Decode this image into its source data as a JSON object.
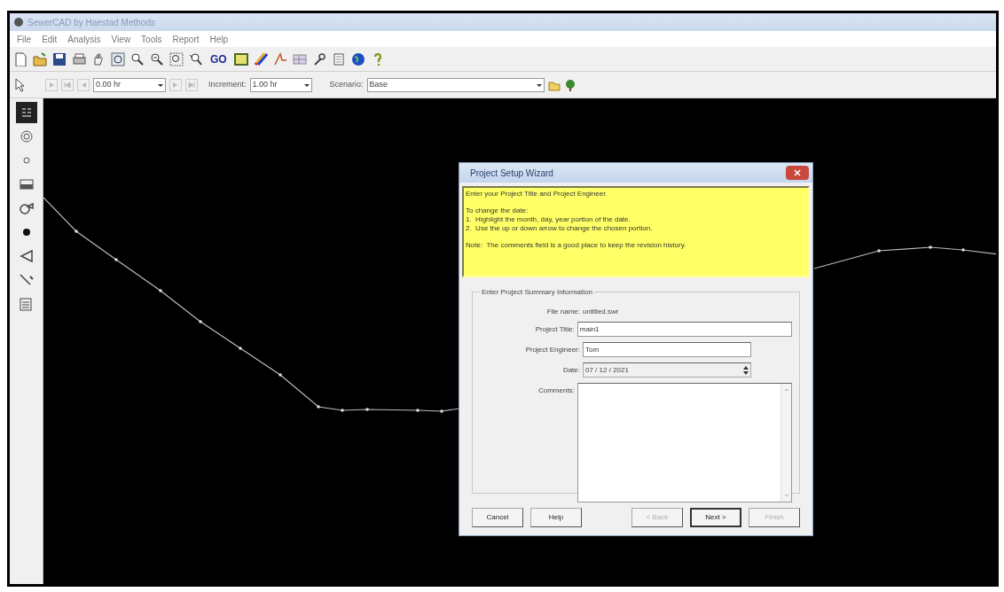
{
  "window": {
    "title": "SewerCAD by Haestad Methods"
  },
  "menu": [
    "File",
    "Edit",
    "Analysis",
    "View",
    "Tools",
    "Report",
    "Help"
  ],
  "toolbar": {
    "go_label": "GO"
  },
  "time_bar": {
    "time": "0.00 hr",
    "increment_label": "Increment:",
    "increment": "1.00 hr",
    "scenario_label": "Scenario:",
    "scenario": "Base"
  },
  "palette": [
    {
      "kind": "label",
      "selected": true
    },
    {
      "kind": "manhole",
      "selected": false
    },
    {
      "kind": "junction",
      "selected": false
    },
    {
      "kind": "wetwell",
      "selected": false
    },
    {
      "kind": "pump",
      "selected": false
    },
    {
      "kind": "node",
      "selected": false
    },
    {
      "kind": "outlet",
      "selected": false
    },
    {
      "kind": "pipe",
      "selected": false
    },
    {
      "kind": "report",
      "selected": false
    }
  ],
  "dialog": {
    "title": "Project Setup Wizard",
    "help_paragraphs": [
      [
        "Enter your Project Title and Project Engineer."
      ],
      [
        "To change the date:",
        "1.  Highlight the month, day, year portion of the date.",
        "2.  Use the up or down arrow to change the chosen portion."
      ],
      [
        "Note:  The comments field is a good place to keep the revision history."
      ]
    ],
    "group_title": "Enter Project Summary Information",
    "file_name_label": "File name:",
    "file_name": "untitled.swr",
    "fields": [
      {
        "kind": "wide_text",
        "label": "Project Title:",
        "value": "main1"
      },
      {
        "kind": "text",
        "label": "Project Engineer:",
        "value": "Tom"
      },
      {
        "kind": "spinner",
        "label": "Date:",
        "value": "07 / 12 / 2021"
      },
      {
        "kind": "memo",
        "label": "Comments:"
      }
    ],
    "buttons": [
      {
        "label": "Cancel",
        "disabled": false,
        "default": false
      },
      {
        "label": "Help",
        "disabled": false,
        "default": false
      },
      {
        "label": "< Back",
        "disabled": true,
        "default": false
      },
      {
        "label": "Next >",
        "disabled": false,
        "default": true
      },
      {
        "label": "Finish",
        "disabled": true,
        "default": false
      }
    ]
  }
}
